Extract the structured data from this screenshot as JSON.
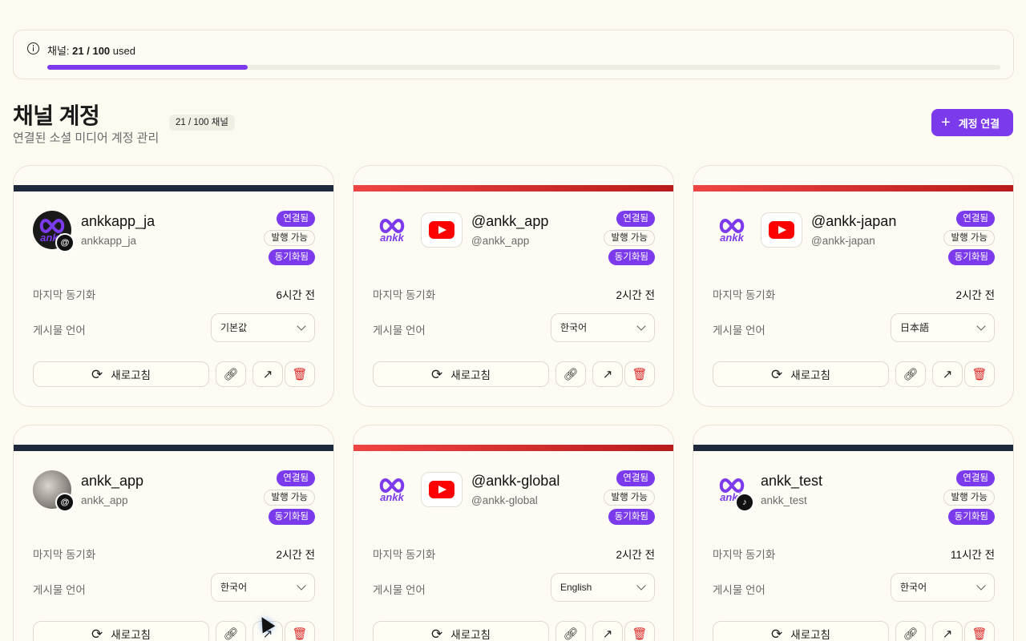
{
  "usage": {
    "label": "채널:",
    "count": "21 / 100",
    "suffix": "used",
    "fraction": 0.21
  },
  "header": {
    "title": "채널 계정",
    "subtitle": "연결된 소셜 미디어 계정 관리",
    "count_badge": "21 / 100 채널",
    "connect_label": "계정 연결"
  },
  "labels": {
    "last_sync": "마지막 동기화",
    "post_language": "게시물 언어",
    "refresh": "새로고침"
  },
  "colors": {
    "accent": "#7c3aed",
    "threads_bar": "#1e293b",
    "youtube_bar": "#dc2626",
    "delete": "#dc2626"
  },
  "cards": [
    {
      "platform": "threads",
      "name": "ankkapp_ja",
      "handle": "ankkapp_ja",
      "badges": [
        "연결됨",
        "발행 가능",
        "동기화됨"
      ],
      "last_sync": "6시간 전",
      "language": "기본값",
      "avatar": "ankk-logo"
    },
    {
      "platform": "youtube",
      "name": "@ankk_app",
      "handle": "@ankk_app",
      "badges": [
        "연결됨",
        "발행 가능",
        "동기화됨"
      ],
      "last_sync": "2시간 전",
      "language": "한국어",
      "avatar": "ankk-logo"
    },
    {
      "platform": "youtube",
      "name": "@ankk-japan",
      "handle": "@ankk-japan",
      "badges": [
        "연결됨",
        "발행 가능",
        "동기화됨"
      ],
      "last_sync": "2시간 전",
      "language": "日本語",
      "avatar": "ankk-logo"
    },
    {
      "platform": "threads",
      "name": "ankk_app",
      "handle": "ankk_app",
      "badges": [
        "연결됨",
        "발행 가능",
        "동기화됨"
      ],
      "last_sync": "2시간 전",
      "language": "한국어",
      "avatar": "photo"
    },
    {
      "platform": "youtube",
      "name": "@ankk-global",
      "handle": "@ankk-global",
      "badges": [
        "연결됨",
        "발행 가능",
        "동기화됨"
      ],
      "last_sync": "2시간 전",
      "language": "English",
      "avatar": "ankk-logo"
    },
    {
      "platform": "tiktok",
      "name": "ankk_test",
      "handle": "ankk_test",
      "badges": [
        "연결됨",
        "발행 가능",
        "동기화됨"
      ],
      "last_sync": "11시간 전",
      "language": "한국어",
      "avatar": "ankk-logo"
    }
  ]
}
